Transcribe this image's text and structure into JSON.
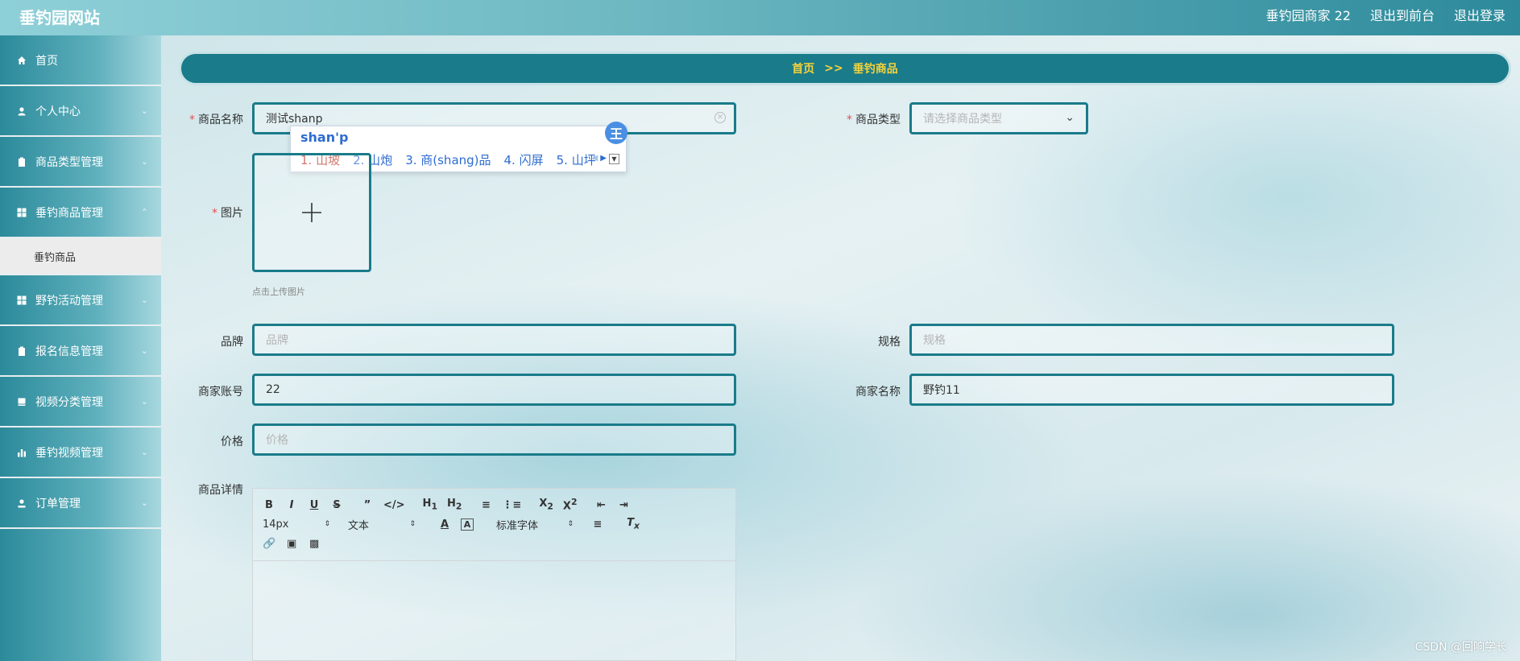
{
  "header": {
    "brand": "垂钓园网站",
    "user_label": "垂钓园商家 22",
    "front_link": "退出到前台",
    "logout_link": "退出登录"
  },
  "sidebar": {
    "items": [
      {
        "label": "首页",
        "icon": "home-icon"
      },
      {
        "label": "个人中心",
        "icon": "user-icon"
      },
      {
        "label": "商品类型管理",
        "icon": "clipboard-icon"
      },
      {
        "label": "垂钓商品管理",
        "icon": "grid-icon"
      },
      {
        "label": "野钓活动管理",
        "icon": "grid-icon"
      },
      {
        "label": "报名信息管理",
        "icon": "clipboard-icon"
      },
      {
        "label": "视频分类管理",
        "icon": "book-icon"
      },
      {
        "label": "垂钓视频管理",
        "icon": "bar-chart-icon"
      },
      {
        "label": "订单管理",
        "icon": "user-icon"
      }
    ],
    "active_sub": "垂钓商品"
  },
  "breadcrumb": {
    "home": "首页",
    "sep": ">>",
    "current": "垂钓商品"
  },
  "form": {
    "name_label": "商品名称",
    "name_value": "测试shanp",
    "type_label": "商品类型",
    "type_placeholder": "请选择商品类型",
    "image_label": "图片",
    "upload_hint": "点击上传图片",
    "brand_label": "品牌",
    "brand_placeholder": "品牌",
    "spec_label": "规格",
    "spec_placeholder": "规格",
    "account_label": "商家账号",
    "account_value": "22",
    "merchant_label": "商家名称",
    "merchant_value": "野钓11",
    "price_label": "价格",
    "price_placeholder": "价格",
    "detail_label": "商品详情"
  },
  "ime": {
    "pinyin": "shan'p",
    "logo": "王",
    "candidates": [
      "1. 山坡",
      "2. 山炮",
      "3. 商(shang)品",
      "4. 闪屏",
      "5. 山坪"
    ]
  },
  "editor": {
    "font_size": "14px",
    "text_style": "文本",
    "font_family": "标准字体"
  },
  "watermark": "CSDN @回响学长",
  "colors": {
    "accent": "#1a7b8a",
    "breadcrumb_text": "#f5d33b",
    "required": "#e25050"
  }
}
